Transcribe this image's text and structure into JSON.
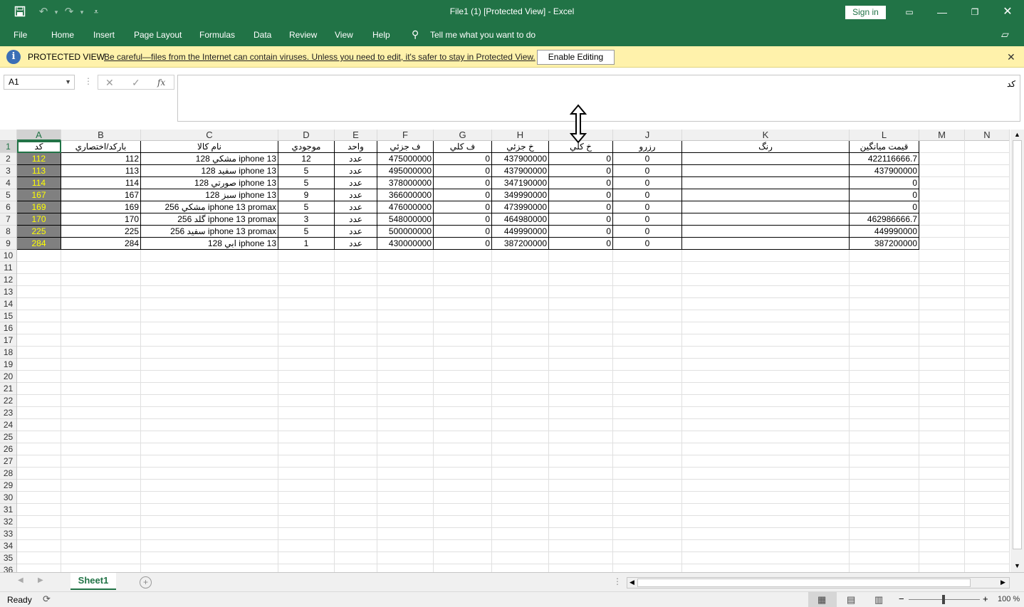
{
  "window": {
    "title": "File1 (1)  [Protected View]  -  Excel",
    "sign_in": "Sign in"
  },
  "menu": [
    "File",
    "Home",
    "Insert",
    "Page Layout",
    "Formulas",
    "Data",
    "Review",
    "View",
    "Help"
  ],
  "tell_me": "Tell me what you want to do",
  "protected_view": {
    "title": "PROTECTED VIEW",
    "message": "Be careful—files from the Internet can contain viruses. Unless you need to edit, it's safer to stay in Protected View.",
    "button": "Enable Editing"
  },
  "name_box": "A1",
  "formula": "کد",
  "columns": [
    "A",
    "B",
    "C",
    "D",
    "E",
    "F",
    "G",
    "H",
    "I",
    "J",
    "K",
    "L",
    "M",
    "N"
  ],
  "selected_column": "A",
  "rows": [
    [
      "کد",
      "بارکد/اختصاري",
      "نام کالا",
      "موجودي",
      "واحد",
      "ف جزئي",
      "ف کلي",
      "خ جزئي",
      "خ کلي",
      "رزرو",
      "رنگ",
      "قيمت ميانگين"
    ],
    [
      "112",
      "112",
      "مشکي 128 iphone 13",
      "12",
      "عدد",
      "475000000",
      "0",
      "437900000",
      "0",
      "0",
      "",
      "422116666.7"
    ],
    [
      "113",
      "113",
      "سفيد 128 iphone 13",
      "5",
      "عدد",
      "495000000",
      "0",
      "437900000",
      "0",
      "0",
      "",
      "437900000"
    ],
    [
      "114",
      "114",
      "صورتي 128 iphone 13",
      "5",
      "عدد",
      "378000000",
      "0",
      "347190000",
      "0",
      "0",
      "",
      "0"
    ],
    [
      "167",
      "167",
      "سبز 128 iphone 13",
      "9",
      "عدد",
      "366000000",
      "0",
      "349990000",
      "0",
      "0",
      "",
      "0"
    ],
    [
      "169",
      "169",
      "مشکي 256 iphone 13 promax",
      "5",
      "عدد",
      "476000000",
      "0",
      "473990000",
      "0",
      "0",
      "",
      "0"
    ],
    [
      "170",
      "170",
      "گلد 256 iphone 13 promax",
      "3",
      "عدد",
      "548000000",
      "0",
      "464980000",
      "0",
      "0",
      "",
      "462986666.7"
    ],
    [
      "225",
      "225",
      "سفيد 256 iphone 13 promax",
      "5",
      "عدد",
      "500000000",
      "0",
      "449990000",
      "0",
      "0",
      "",
      "449990000"
    ],
    [
      "284",
      "284",
      "ابي 128 iphone 13",
      "1",
      "عدد",
      "430000000",
      "0",
      "387200000",
      "0",
      "0",
      "",
      "387200000"
    ]
  ],
  "row_count": 36,
  "sheet_tab": "Sheet1",
  "status": "Ready",
  "zoom": "100 %"
}
